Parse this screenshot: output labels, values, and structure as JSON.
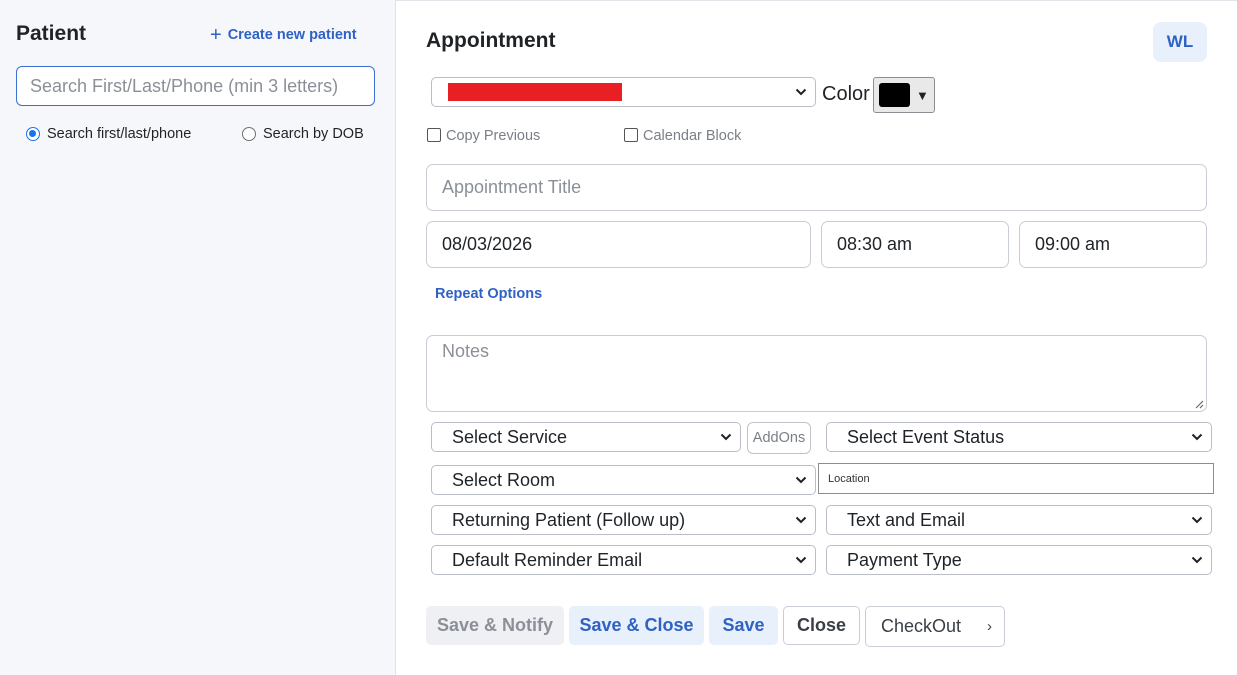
{
  "patient_panel": {
    "title": "Patient",
    "create_label": "Create new patient",
    "search_placeholder": "Search First/Last/Phone (min 3 letters)",
    "radio_options": [
      {
        "label": "Search first/last/phone",
        "checked": true
      },
      {
        "label": "Search by DOB",
        "checked": false
      }
    ]
  },
  "appointment": {
    "title": "Appointment",
    "wl_label": "WL",
    "provider_select": {
      "value": "",
      "redacted": true
    },
    "color_label": "Color",
    "color_value": "#000000",
    "copy_previous_label": "Copy Previous",
    "calendar_block_label": "Calendar Block",
    "title_placeholder": "Appointment Title",
    "date": "08/03/2026",
    "start_time": "08:30 am",
    "end_time": "09:00 am",
    "repeat_label": "Repeat Options",
    "notes_placeholder": "Notes",
    "service_select": "Select Service",
    "addons_label": "AddOns",
    "event_status_select": "Select Event Status",
    "room_select": "Select Room",
    "location_text": "Location",
    "patient_type_select": "Returning Patient (Follow up)",
    "notify_method_select": "Text and Email",
    "reminder_select": "Default Reminder Email",
    "payment_select": "Payment Type"
  },
  "actions": {
    "save_notify": "Save & Notify",
    "save_close": "Save & Close",
    "save": "Save",
    "close": "Close",
    "checkout": "CheckOut",
    "checkout_arrow": "›"
  },
  "colors": {
    "accent": "#2f62c4",
    "radio_accent": "#1a73e8",
    "redaction": "#e81f23",
    "soft_button_bg": "#e8f0fc"
  }
}
